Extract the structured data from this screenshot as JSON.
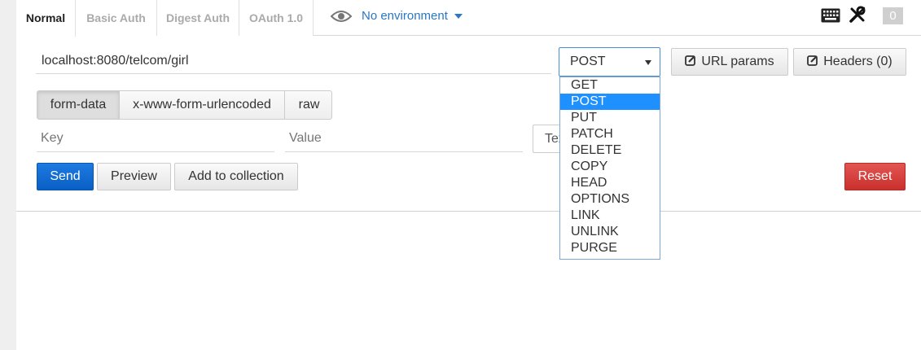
{
  "auth_tabs": [
    {
      "label": "Normal",
      "active": true
    },
    {
      "label": "Basic Auth",
      "active": false
    },
    {
      "label": "Digest Auth",
      "active": false
    },
    {
      "label": "OAuth 1.0",
      "active": false
    }
  ],
  "environment": {
    "label": "No environment"
  },
  "header_right": {
    "badge_count": "0"
  },
  "request": {
    "url": "localhost:8080/telcom/girl",
    "method": "POST",
    "url_params_label": "URL params",
    "headers_label": "Headers (0)"
  },
  "body_tabs": [
    {
      "label": "form-data",
      "active": true
    },
    {
      "label": "x-www-form-urlencoded",
      "active": false
    },
    {
      "label": "raw",
      "active": false
    }
  ],
  "form_row": {
    "key_placeholder": "Key",
    "value_placeholder": "Value",
    "type_value": "Text"
  },
  "actions": {
    "send": "Send",
    "preview": "Preview",
    "add_to_collection": "Add to collection",
    "reset": "Reset"
  },
  "method_options": [
    "GET",
    "POST",
    "PUT",
    "PATCH",
    "DELETE",
    "COPY",
    "HEAD",
    "OPTIONS",
    "LINK",
    "UNLINK",
    "PURGE"
  ],
  "colors": {
    "accent_blue": "#2a77c4",
    "send_blue": "#0a5fc5",
    "reset_red": "#c9302c",
    "selected_option": "#1e90ff"
  },
  "icons": [
    "eye-icon",
    "keyboard-icon",
    "wrench-icon",
    "edit-icon"
  ]
}
